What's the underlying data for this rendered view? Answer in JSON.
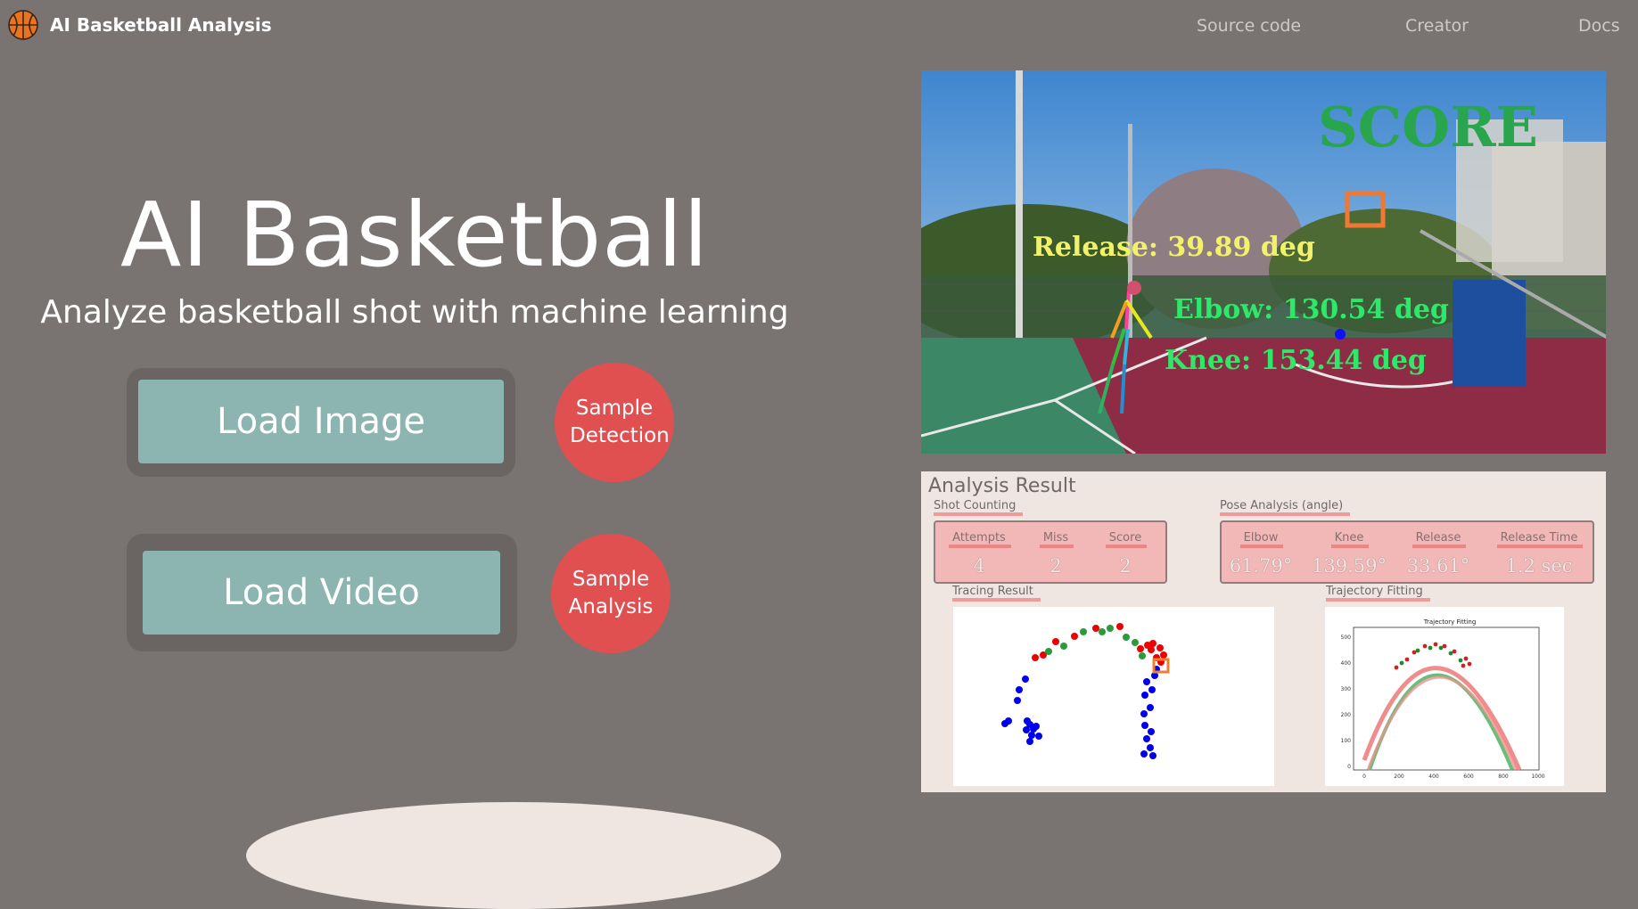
{
  "app": {
    "title": "AI Basketball Analysis"
  },
  "nav": {
    "source_code": "Source code",
    "creator": "Creator",
    "docs": "Docs"
  },
  "hero": {
    "title": "AI Basketball",
    "subtitle": "Analyze basketball shot with machine learning"
  },
  "buttons": {
    "load_image": "Load Image",
    "load_video": "Load Video",
    "sample_detection": "Sample Detection",
    "sample_analysis": "Sample Analysis"
  },
  "overlay": {
    "score": "SCORE",
    "release": "Release: 39.89 deg",
    "elbow": "Elbow: 130.54 deg",
    "knee": "Knee: 153.44 deg"
  },
  "analysis": {
    "title": "Analysis Result",
    "shot_counting": {
      "label": "Shot Counting",
      "attempts": {
        "label": "Attempts",
        "value": "4"
      },
      "miss": {
        "label": "Miss",
        "value": "2"
      },
      "score": {
        "label": "Score",
        "value": "2"
      }
    },
    "pose": {
      "label": "Pose Analysis (angle)",
      "elbow": {
        "label": "Elbow",
        "value": "61.79°"
      },
      "knee": {
        "label": "Knee",
        "value": "139.59°"
      },
      "release": {
        "label": "Release",
        "value": "33.61°"
      },
      "release_time": {
        "label": "Release Time",
        "value": "1.2 sec"
      }
    },
    "tracing_label": "Tracing Result",
    "fitting_label": "Trajectory Fitting",
    "fitting_chart_title": "Trajectory Fitting",
    "fitting_x_ticks": [
      "0",
      "200",
      "400",
      "600",
      "800",
      "1000"
    ],
    "fitting_y_ticks": [
      "500",
      "400",
      "300",
      "200",
      "100",
      "0"
    ]
  },
  "colors": {
    "background": "#797472",
    "button": "#8cb5b1",
    "accent_red": "#e05050",
    "panel": "#efe6e2"
  }
}
